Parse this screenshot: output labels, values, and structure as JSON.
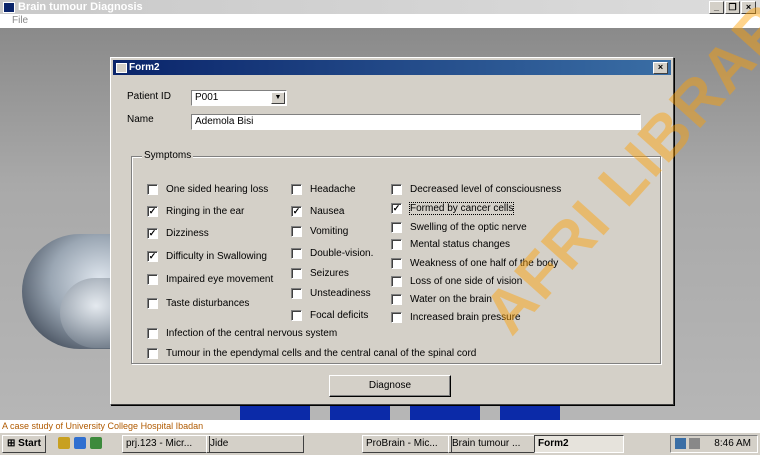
{
  "app": {
    "title": "Brain tumour Diagnosis",
    "menu": [
      "File"
    ],
    "buttons": [
      "_",
      "❐",
      "×"
    ]
  },
  "form": {
    "title": "Form2",
    "close": "×",
    "patient_id_label": "Patient ID",
    "patient_id_value": "P001",
    "name_label": "Name",
    "name_value": "Ademola Bisi",
    "symptoms_label": "Symptoms",
    "col1": [
      {
        "label": "One sided hearing loss",
        "checked": false
      },
      {
        "label": "Ringing in the ear",
        "checked": true
      },
      {
        "label": "Dizziness",
        "checked": true
      },
      {
        "label": "Difficulty in Swallowing",
        "checked": true
      },
      {
        "label": "Impaired eye movement",
        "checked": false
      },
      {
        "label": "Taste disturbances",
        "checked": false
      }
    ],
    "col2": [
      {
        "label": "Headache",
        "checked": false
      },
      {
        "label": "Nausea",
        "checked": true
      },
      {
        "label": "Vomiting",
        "checked": false
      },
      {
        "label": "Double-vision.",
        "checked": false
      },
      {
        "label": "Seizures",
        "checked": false
      },
      {
        "label": "Unsteadiness",
        "checked": false
      },
      {
        "label": "Focal deficits",
        "checked": false
      }
    ],
    "col3": [
      {
        "label": "Decreased level of consciousness",
        "checked": false
      },
      {
        "label": "Formed by cancer cells",
        "checked": true
      },
      {
        "label": "Swelling of the optic nerve",
        "checked": false
      },
      {
        "label": "Mental status changes",
        "checked": false
      },
      {
        "label": "Weakness of one half of the body",
        "checked": false
      },
      {
        "label": "Loss of one side of vision",
        "checked": false
      },
      {
        "label": "Water on the brain",
        "checked": false
      },
      {
        "label": "Increased brain pressure",
        "checked": false
      }
    ],
    "wide": [
      {
        "label": "Infection of the central nervous system",
        "checked": false
      },
      {
        "label": "Tumour in the ependymal cells and the central canal of the spinal cord",
        "checked": false
      }
    ],
    "diagnose_label": "Diagnose"
  },
  "status_text": "A case study of University College Hospital Ibadan",
  "taskbar": {
    "start": "Start",
    "items": [
      "prj.123 - Micr...",
      "Jide",
      "ProBrain - Mic...",
      "Brain tumour ...",
      "Form2"
    ],
    "clock": "8:46 AM"
  },
  "watermark": "AFRI LIBRARY",
  "colors": {
    "title_active": "#0a246a",
    "title_active_end": "#3a6ea5",
    "face": "#d4d0c8",
    "watermark": "#ffa000"
  }
}
